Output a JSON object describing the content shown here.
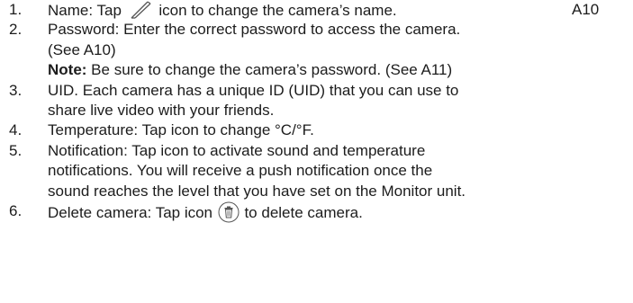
{
  "items": [
    {
      "num": "1.",
      "before_icon": "Name: Tap ",
      "icon": "pen-icon",
      "after_icon": " icon to change the camera’s name.",
      "ref": "A10"
    },
    {
      "num": "2.",
      "line1": "Password: Enter the correct password to access the camera.",
      "line2": "(See A10)",
      "note_label": "Note:",
      "note_text": " Be sure to change the camera’s password. (See A11)"
    },
    {
      "num": "3.",
      "line1": "UID. Each camera has a unique ID (UID) that you can use to",
      "line2": "share live video with your friends."
    },
    {
      "num": "4.",
      "text": "Temperature: Tap icon to change °C/°F."
    },
    {
      "num": "5.",
      "line1": "Notification: Tap icon to activate sound and  temperature",
      "line2": "notifications. You will receive a push notification once the",
      "line3": "sound reaches the level that you have set on the Monitor unit."
    },
    {
      "num": "6.",
      "before_icon": "Delete camera: Tap icon ",
      "icon": "trash-icon",
      "after_icon": " to delete camera."
    }
  ]
}
